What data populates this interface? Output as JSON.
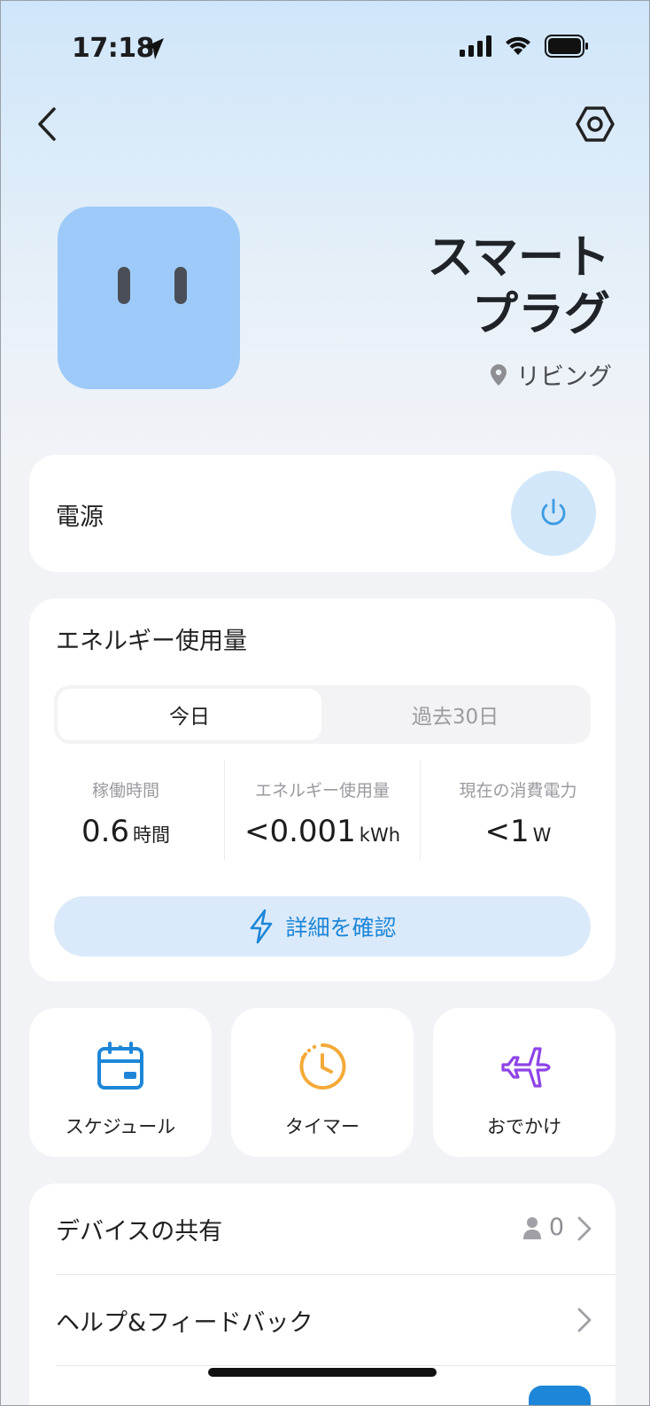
{
  "status_bar": {
    "time": "17:18"
  },
  "device": {
    "title": "スマート プラグ",
    "room": "リビング"
  },
  "power": {
    "label": "電源"
  },
  "energy": {
    "title": "エネルギー使用量",
    "tabs": [
      "今日",
      "過去30日"
    ],
    "stats": [
      {
        "label": "稼働時間",
        "value": "0.6",
        "unit": "時間"
      },
      {
        "label": "エネルギー使用量",
        "value": "<0.001",
        "unit": "kWh"
      },
      {
        "label": "現在の消費電力",
        "value": "<1",
        "unit": "W"
      }
    ],
    "details_label": "詳細を確認"
  },
  "quick_actions": [
    {
      "label": "スケジュール",
      "icon": "calendar-icon",
      "color": "#1d86d8"
    },
    {
      "label": "タイマー",
      "icon": "timer-icon",
      "color": "#f4a938"
    },
    {
      "label": "おでかけ",
      "icon": "airplane-icon",
      "color": "#8e44e8"
    }
  ],
  "list": {
    "share_label": "デバイスの共有",
    "share_count": "0",
    "help_label": "ヘルプ&フィードバック"
  },
  "colors": {
    "accent": "#1d86d8",
    "device_icon_bg": "#9dcaf8",
    "power_button_bg": "#d2e7fa"
  }
}
